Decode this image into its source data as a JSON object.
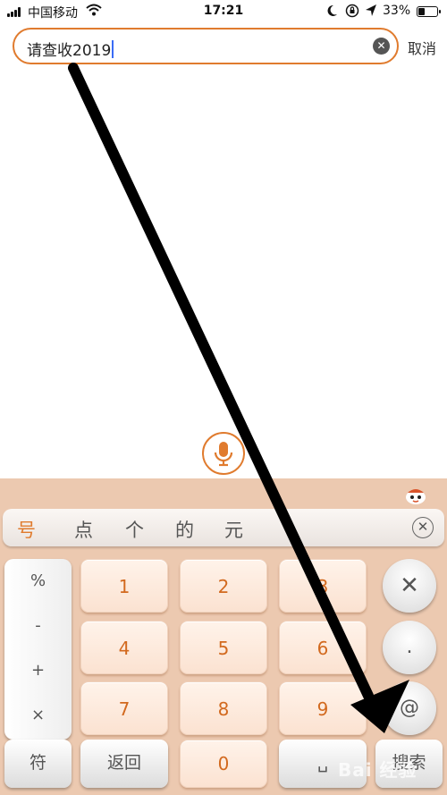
{
  "status_bar": {
    "carrier": "中国移动",
    "time": "17:21",
    "battery_percent": "33%",
    "battery_level": 0.33
  },
  "search": {
    "query": "请查收2019",
    "cancel_label": "取消"
  },
  "keyboard": {
    "candidates": [
      "号",
      "点",
      "个",
      "的",
      "元"
    ],
    "symbols": [
      "%",
      "-",
      "+",
      "×"
    ],
    "digits": [
      "1",
      "2",
      "3",
      "4",
      "5",
      "6",
      "7",
      "8",
      "9",
      "0"
    ],
    "side_keys": {
      "delete": "✕",
      "dot": ".",
      "at": "@"
    },
    "bottom": {
      "symbol_label": "符",
      "back_label": "返回",
      "space_label": "␣",
      "search_label": "搜索"
    }
  },
  "colors": {
    "accent": "#e07b2e",
    "keyboard_bg": "#ecc9b0",
    "cursor": "#3a6cf5"
  },
  "watermark": "Bai 经验"
}
